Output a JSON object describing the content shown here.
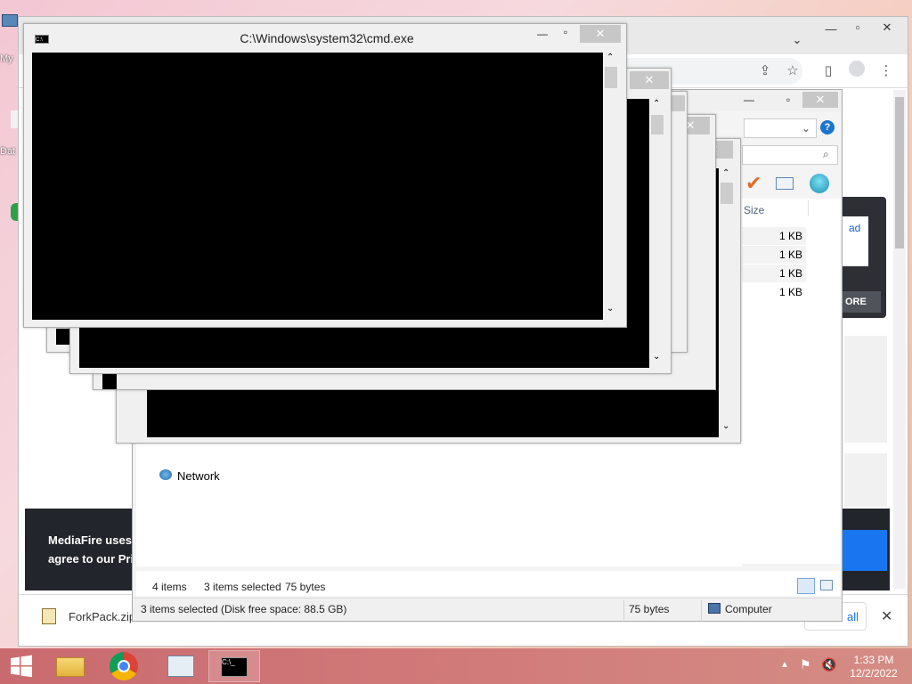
{
  "desktop": {
    "icons": [
      {
        "label": "My",
        "icon": "computer-icon"
      },
      {
        "label": "Dat",
        "icon": "file-icon"
      }
    ]
  },
  "browser": {
    "toolbar_icons": [
      "share-icon",
      "star-icon",
      "side-panel-icon",
      "profile-icon",
      "menu-icon"
    ],
    "mediafire": {
      "download_label": "ad",
      "more_label": "ORE",
      "cookie_line1": "MediaFire uses c",
      "cookie_line2": "agree to our Priv"
    },
    "download": {
      "file_name": "ForkPack.zip",
      "show_all": "all"
    }
  },
  "explorer": {
    "columns": {
      "size": "Size"
    },
    "rows": [
      {
        "size": "1 KB"
      },
      {
        "size": "1 KB"
      },
      {
        "size": "1 KB"
      },
      {
        "size": "1 KB"
      }
    ],
    "nav": {
      "network": "Network"
    },
    "details": {
      "items": "4 items",
      "selected": "3 items selected",
      "bytes": "75 bytes"
    },
    "status": {
      "selection": "3 items selected (Disk free space: 88.5 GB)",
      "size": "75 bytes",
      "location": "Computer"
    }
  },
  "cmd": {
    "title": "C:\\Windows\\system32\\cmd.exe"
  },
  "taskbar": {
    "apps": [
      "start-icon",
      "file-explorer-icon",
      "chrome-icon",
      "task-manager-icon",
      "cmd-icon"
    ],
    "time": "1:33 PM",
    "date": "12/2/2022"
  }
}
